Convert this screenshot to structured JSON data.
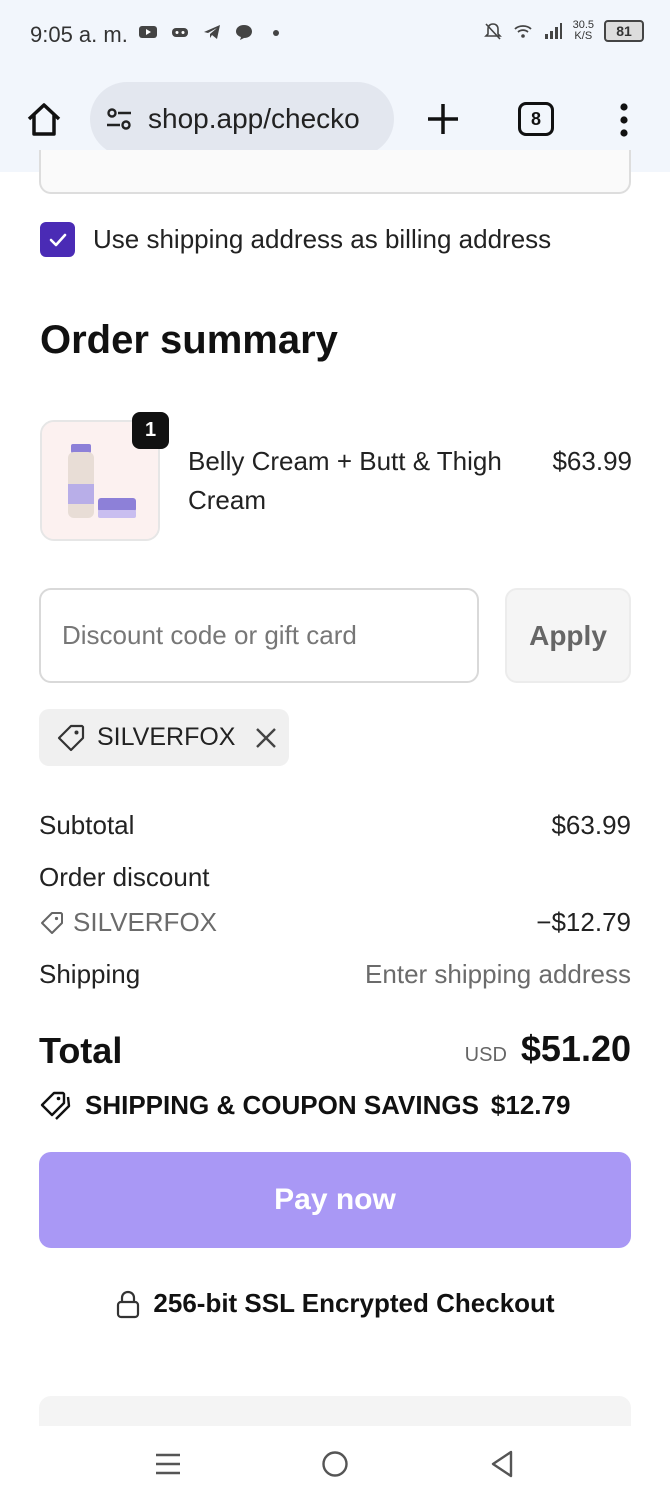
{
  "status_bar": {
    "time": "9:05 a. m.",
    "net_speed_value": "30.5",
    "net_speed_unit": "K/S",
    "battery": "81"
  },
  "browser": {
    "url": "shop.app/checko",
    "tab_count": "8"
  },
  "checkout": {
    "billing_checkbox_label": "Use shipping address as billing address",
    "billing_checked": true,
    "order_summary_title": "Order summary",
    "product": {
      "name": "Belly Cream + Butt & Thigh Cream",
      "price": "$63.99",
      "quantity": "1"
    },
    "discount": {
      "placeholder": "Discount code or gift card",
      "value": "",
      "apply_label": "Apply",
      "applied_code": "SILVERFOX"
    },
    "totals": {
      "subtotal_label": "Subtotal",
      "subtotal_value": "$63.99",
      "order_discount_label": "Order discount",
      "discount_code": "SILVERFOX",
      "discount_value": "−$12.79",
      "shipping_label": "Shipping",
      "shipping_value": "Enter shipping address",
      "total_label": "Total",
      "currency": "USD",
      "total_value": "$51.20",
      "savings_label": "SHIPPING & COUPON SAVINGS",
      "savings_value": "$12.79"
    },
    "pay_label": "Pay now",
    "ssl_label": "256-bit SSL Encrypted Checkout"
  },
  "colors": {
    "accent": "#4a2bb5",
    "pay_button": "#a998f5",
    "chrome_bg": "#f2f6fc"
  }
}
